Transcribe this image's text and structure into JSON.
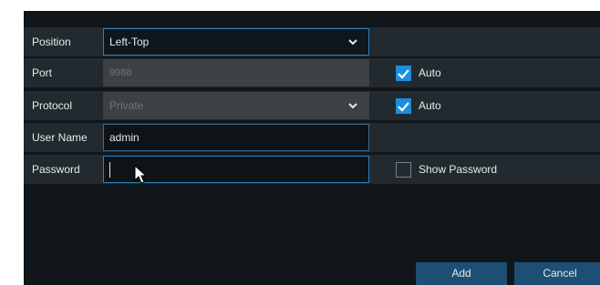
{
  "form": {
    "position": {
      "label": "Position",
      "value": "Left-Top"
    },
    "port": {
      "label": "Port",
      "value": "9988",
      "auto_checked": true,
      "auto_label": "Auto"
    },
    "protocol": {
      "label": "Protocol",
      "value": "Private",
      "auto_checked": true,
      "auto_label": "Auto"
    },
    "user_name": {
      "label": "User Name",
      "value": "admin"
    },
    "password": {
      "label": "Password",
      "value": "",
      "show_password_checked": false,
      "show_password_label": "Show Password"
    }
  },
  "buttons": {
    "add": "Add",
    "cancel": "Cancel"
  },
  "colors": {
    "accent": "#1a8fdd",
    "button": "#1e4e74",
    "focus_border": "#2e7fb9"
  }
}
